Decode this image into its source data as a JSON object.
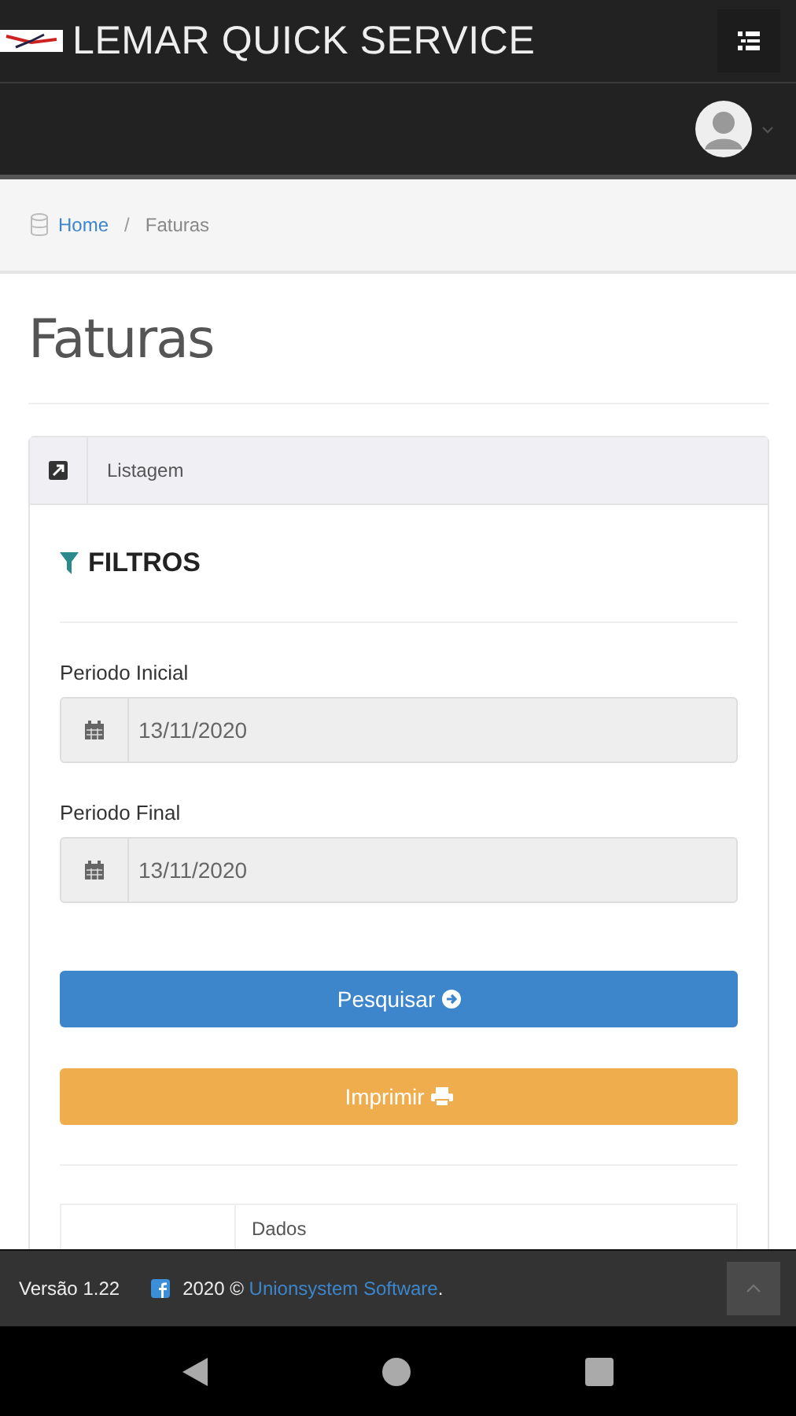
{
  "header": {
    "brand": "LEMAR QUICK SERVICE"
  },
  "breadcrumb_separator": "/",
  "breadcrumb": [
    {
      "label": "Home",
      "selected": false
    },
    {
      "label": "Faturas",
      "selected": true
    }
  ],
  "page_title": "Faturas",
  "panel": {
    "tab": "Listagem",
    "filters_title": "FILTROS",
    "fields": [
      {
        "label": "Periodo Inicial",
        "value": "13/11/2020"
      },
      {
        "label": "Periodo Final",
        "value": "13/11/2020"
      }
    ],
    "buttons": [
      {
        "label": "Pesquisar",
        "kind": "search"
      },
      {
        "label": "Imprimir",
        "kind": "print"
      }
    ],
    "table": {
      "columns": [
        "Dados"
      ]
    }
  },
  "footer": {
    "version": "Versão 1.22",
    "copyright": "2020 ©",
    "link": "Unionsystem Software",
    "tail": "."
  }
}
